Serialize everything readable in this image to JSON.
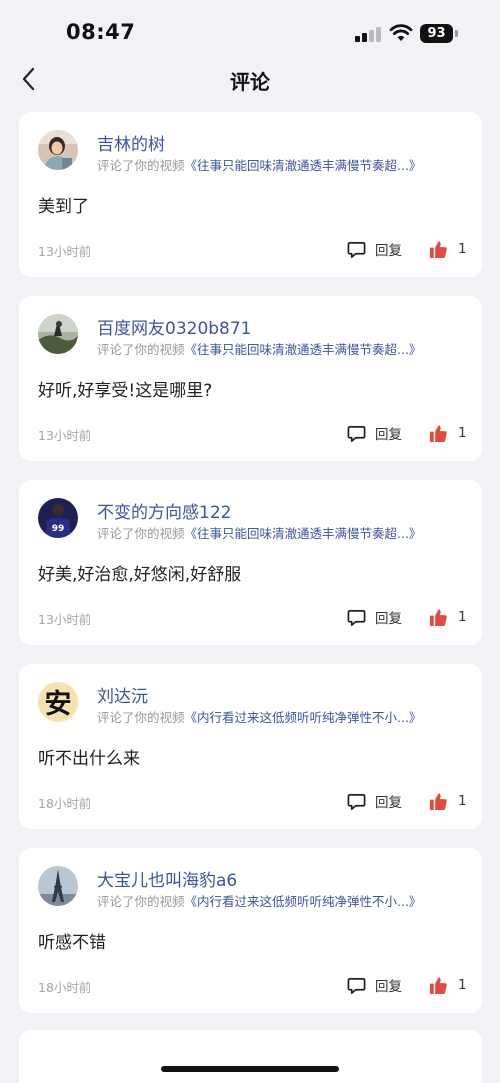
{
  "status": {
    "time": "08:47",
    "battery": "93"
  },
  "nav": {
    "title": "评论"
  },
  "colors": {
    "accent": "#3a55a4",
    "like": "#e34b3c",
    "background": "#f2f2f6"
  },
  "comments": [
    {
      "user": "吉林的树",
      "prefix": "评论了你的视频",
      "video": "《往事只能回味清澈通透丰满慢节奏超...》",
      "text": "美到了",
      "time": "13小时前",
      "reply": "回复",
      "likes": "1",
      "avatar": "photo-woman-avatar"
    },
    {
      "user": "百度网友0320b871",
      "prefix": "评论了你的视频",
      "video": "《往事只能回味清澈通透丰满慢节奏超...》",
      "text": "好听,好享受!这是哪里?",
      "time": "13小时前",
      "reply": "回复",
      "likes": "1",
      "avatar": "photo-landscape-avatar"
    },
    {
      "user": "不变的方向感122",
      "prefix": "评论了你的视频",
      "video": "《往事只能回味清澈通透丰满慢节奏超...》",
      "text": "好美,好治愈,好悠闲,好舒服",
      "time": "13小时前",
      "reply": "回复",
      "likes": "1",
      "avatar": "jersey-99-avatar"
    },
    {
      "user": "刘达沅",
      "prefix": "评论了你的视频",
      "video": "《内行看过来这低频听听纯净弹性不小...》",
      "text": "听不出什么来",
      "time": "18小时前",
      "reply": "回复",
      "likes": "1",
      "avatar": "an-character-avatar",
      "avatar_char": "安"
    },
    {
      "user": "大宝儿也叫海豹a6",
      "prefix": "评论了你的视频",
      "video": "《内行看过来这低频听听纯净弹性不小...》",
      "text": "听感不错",
      "time": "18小时前",
      "reply": "回复",
      "likes": "1",
      "avatar": "eiffel-tower-avatar"
    }
  ]
}
